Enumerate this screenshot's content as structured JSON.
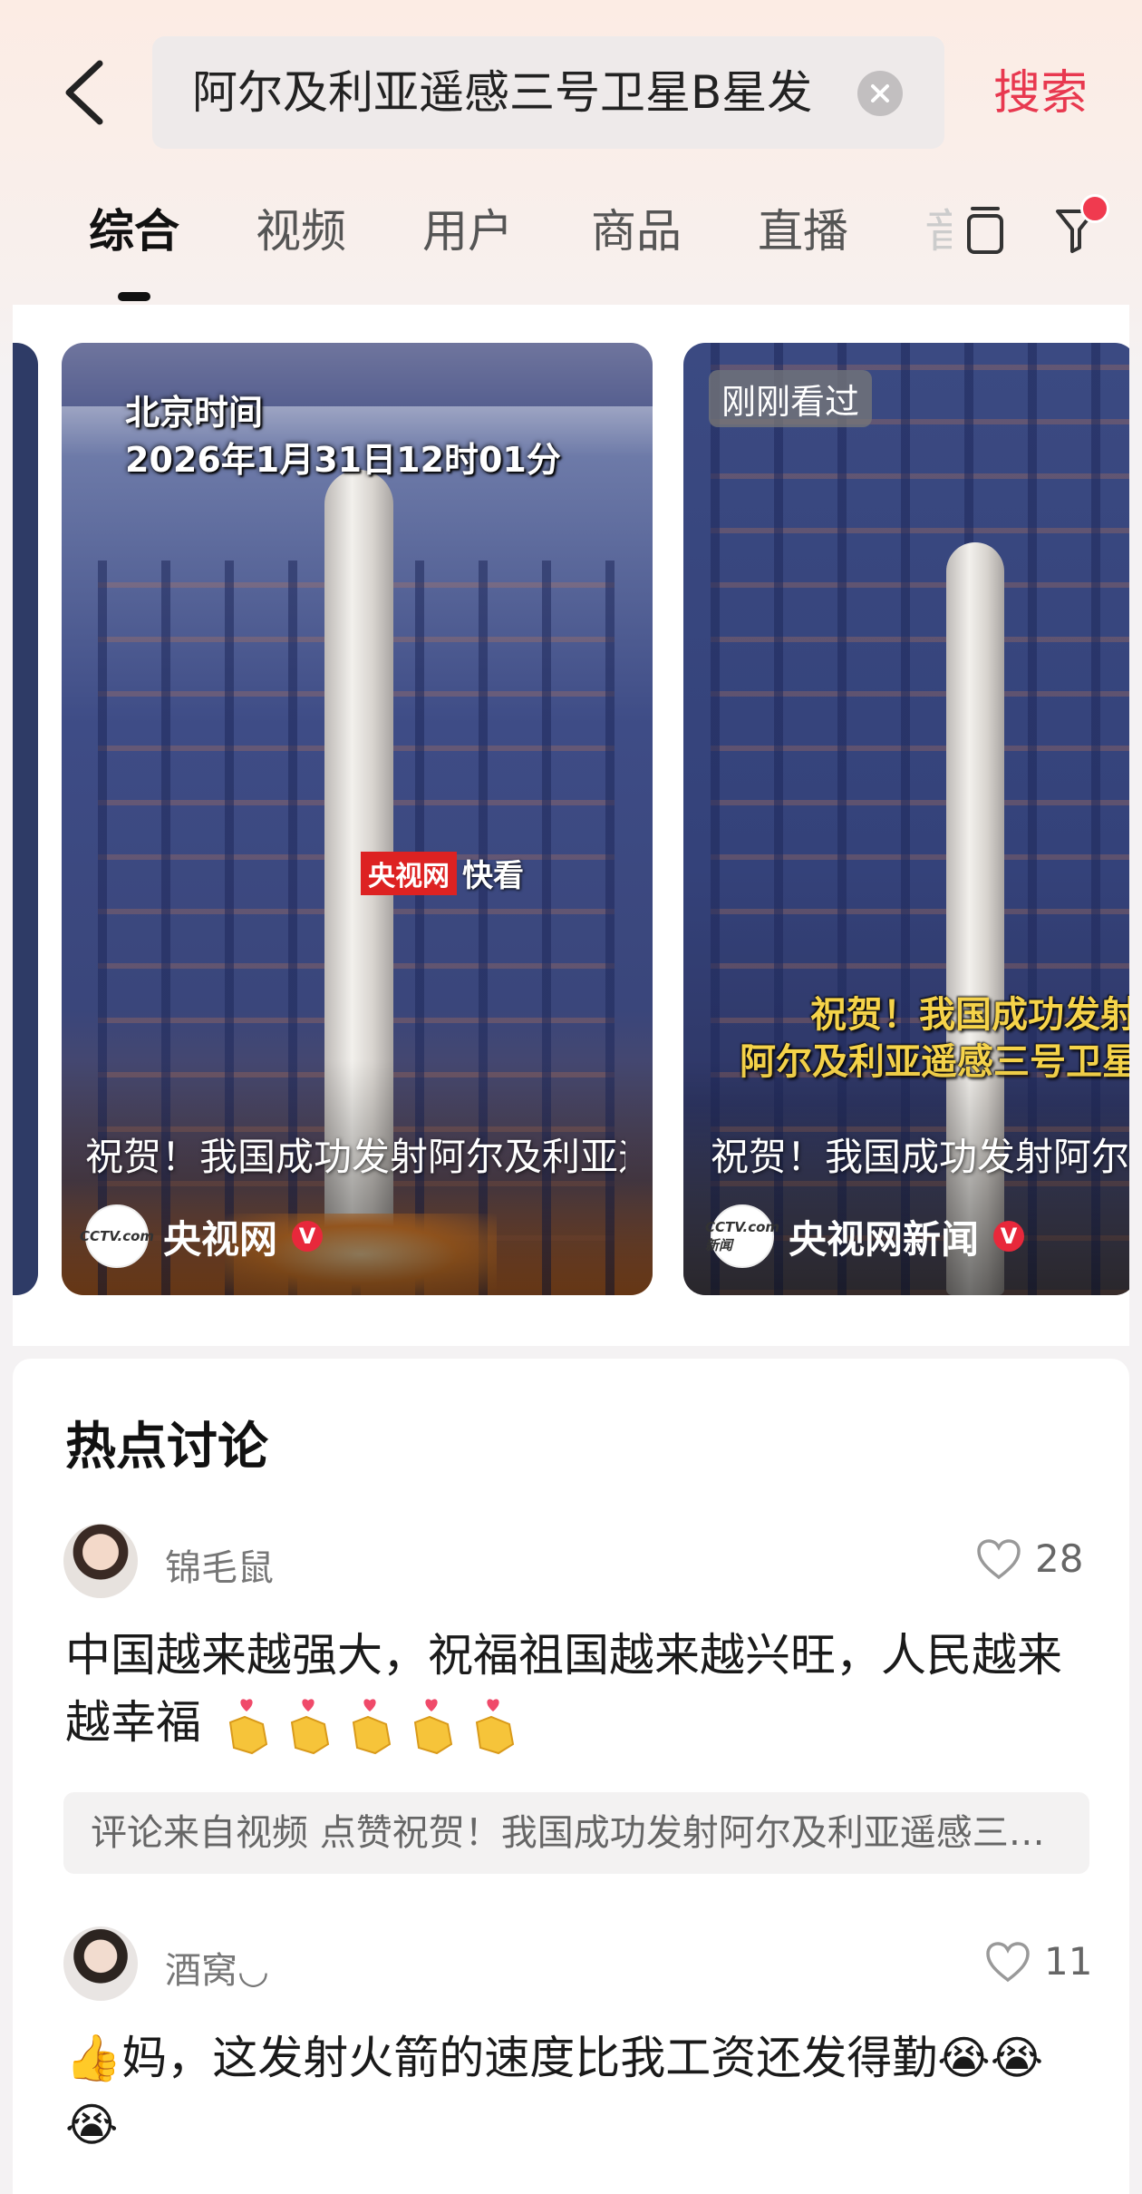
{
  "header": {
    "search_query": "阿尔及利亚遥感三号卫星B星发",
    "search_button": "搜索"
  },
  "tabs": [
    {
      "label": "综合",
      "active": true
    },
    {
      "label": "视频"
    },
    {
      "label": "用户"
    },
    {
      "label": "商品"
    },
    {
      "label": "直播"
    }
  ],
  "tabs_truncated_label": "音",
  "icons": {
    "back": "chevron-left-icon",
    "clear": "clear-icon",
    "layout": "layout-icon",
    "filter": "filter-icon"
  },
  "accent_color": "#e8384f",
  "videos": [
    {
      "time_line1": "北京时间",
      "time_line2": "2026年1月31日12时01分",
      "watermark_badge": "央视网",
      "watermark_text": "快看",
      "title": "祝贺！我国成功发射阿尔及利亚遥感三号卫星B星",
      "author": "央视网",
      "verified": true,
      "avatar_text": "CCTV.com"
    },
    {
      "badge": "刚刚看过",
      "caption_line1": "祝贺！我国成功发射",
      "caption_line2": "阿尔及利亚遥感三号卫星",
      "title": "祝贺！我国成功发射阿尔及利亚遥感三号卫星B星",
      "author": "央视网新闻",
      "verified": true,
      "avatar_text": "CCTV.com 新闻"
    }
  ],
  "hot_discussion": {
    "title": "热点讨论",
    "comments": [
      {
        "user": "锦毛鼠",
        "likes": "28",
        "text": "中国越来越强大，祝福祖国越来越兴旺，人民越来越幸福",
        "emoji_count": 5,
        "source": "评论来自视频 点赞祝贺！我国成功发射阿尔及利亚遥感三号卫星B星"
      },
      {
        "user": "酒窝◡",
        "likes": "11",
        "text_prefix": "👍",
        "text": "妈，这发射火箭的速度比我工资还发得勤",
        "trailing_emoji": "😭😭😭"
      }
    ]
  }
}
